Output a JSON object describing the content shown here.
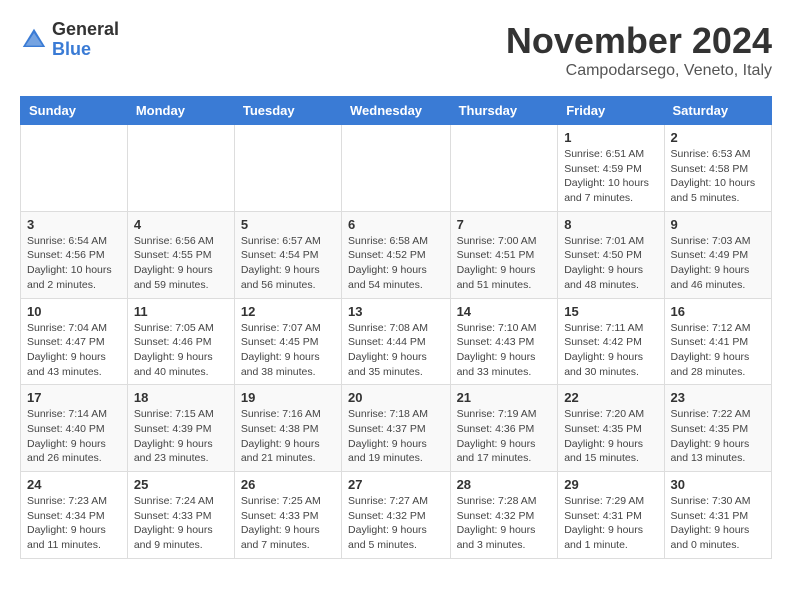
{
  "header": {
    "logo_general": "General",
    "logo_blue": "Blue",
    "month_title": "November 2024",
    "location": "Campodarsego, Veneto, Italy"
  },
  "weekdays": [
    "Sunday",
    "Monday",
    "Tuesday",
    "Wednesday",
    "Thursday",
    "Friday",
    "Saturday"
  ],
  "weeks": [
    [
      {
        "day": "",
        "info": ""
      },
      {
        "day": "",
        "info": ""
      },
      {
        "day": "",
        "info": ""
      },
      {
        "day": "",
        "info": ""
      },
      {
        "day": "",
        "info": ""
      },
      {
        "day": "1",
        "info": "Sunrise: 6:51 AM\nSunset: 4:59 PM\nDaylight: 10 hours and 7 minutes."
      },
      {
        "day": "2",
        "info": "Sunrise: 6:53 AM\nSunset: 4:58 PM\nDaylight: 10 hours and 5 minutes."
      }
    ],
    [
      {
        "day": "3",
        "info": "Sunrise: 6:54 AM\nSunset: 4:56 PM\nDaylight: 10 hours and 2 minutes."
      },
      {
        "day": "4",
        "info": "Sunrise: 6:56 AM\nSunset: 4:55 PM\nDaylight: 9 hours and 59 minutes."
      },
      {
        "day": "5",
        "info": "Sunrise: 6:57 AM\nSunset: 4:54 PM\nDaylight: 9 hours and 56 minutes."
      },
      {
        "day": "6",
        "info": "Sunrise: 6:58 AM\nSunset: 4:52 PM\nDaylight: 9 hours and 54 minutes."
      },
      {
        "day": "7",
        "info": "Sunrise: 7:00 AM\nSunset: 4:51 PM\nDaylight: 9 hours and 51 minutes."
      },
      {
        "day": "8",
        "info": "Sunrise: 7:01 AM\nSunset: 4:50 PM\nDaylight: 9 hours and 48 minutes."
      },
      {
        "day": "9",
        "info": "Sunrise: 7:03 AM\nSunset: 4:49 PM\nDaylight: 9 hours and 46 minutes."
      }
    ],
    [
      {
        "day": "10",
        "info": "Sunrise: 7:04 AM\nSunset: 4:47 PM\nDaylight: 9 hours and 43 minutes."
      },
      {
        "day": "11",
        "info": "Sunrise: 7:05 AM\nSunset: 4:46 PM\nDaylight: 9 hours and 40 minutes."
      },
      {
        "day": "12",
        "info": "Sunrise: 7:07 AM\nSunset: 4:45 PM\nDaylight: 9 hours and 38 minutes."
      },
      {
        "day": "13",
        "info": "Sunrise: 7:08 AM\nSunset: 4:44 PM\nDaylight: 9 hours and 35 minutes."
      },
      {
        "day": "14",
        "info": "Sunrise: 7:10 AM\nSunset: 4:43 PM\nDaylight: 9 hours and 33 minutes."
      },
      {
        "day": "15",
        "info": "Sunrise: 7:11 AM\nSunset: 4:42 PM\nDaylight: 9 hours and 30 minutes."
      },
      {
        "day": "16",
        "info": "Sunrise: 7:12 AM\nSunset: 4:41 PM\nDaylight: 9 hours and 28 minutes."
      }
    ],
    [
      {
        "day": "17",
        "info": "Sunrise: 7:14 AM\nSunset: 4:40 PM\nDaylight: 9 hours and 26 minutes."
      },
      {
        "day": "18",
        "info": "Sunrise: 7:15 AM\nSunset: 4:39 PM\nDaylight: 9 hours and 23 minutes."
      },
      {
        "day": "19",
        "info": "Sunrise: 7:16 AM\nSunset: 4:38 PM\nDaylight: 9 hours and 21 minutes."
      },
      {
        "day": "20",
        "info": "Sunrise: 7:18 AM\nSunset: 4:37 PM\nDaylight: 9 hours and 19 minutes."
      },
      {
        "day": "21",
        "info": "Sunrise: 7:19 AM\nSunset: 4:36 PM\nDaylight: 9 hours and 17 minutes."
      },
      {
        "day": "22",
        "info": "Sunrise: 7:20 AM\nSunset: 4:35 PM\nDaylight: 9 hours and 15 minutes."
      },
      {
        "day": "23",
        "info": "Sunrise: 7:22 AM\nSunset: 4:35 PM\nDaylight: 9 hours and 13 minutes."
      }
    ],
    [
      {
        "day": "24",
        "info": "Sunrise: 7:23 AM\nSunset: 4:34 PM\nDaylight: 9 hours and 11 minutes."
      },
      {
        "day": "25",
        "info": "Sunrise: 7:24 AM\nSunset: 4:33 PM\nDaylight: 9 hours and 9 minutes."
      },
      {
        "day": "26",
        "info": "Sunrise: 7:25 AM\nSunset: 4:33 PM\nDaylight: 9 hours and 7 minutes."
      },
      {
        "day": "27",
        "info": "Sunrise: 7:27 AM\nSunset: 4:32 PM\nDaylight: 9 hours and 5 minutes."
      },
      {
        "day": "28",
        "info": "Sunrise: 7:28 AM\nSunset: 4:32 PM\nDaylight: 9 hours and 3 minutes."
      },
      {
        "day": "29",
        "info": "Sunrise: 7:29 AM\nSunset: 4:31 PM\nDaylight: 9 hours and 1 minute."
      },
      {
        "day": "30",
        "info": "Sunrise: 7:30 AM\nSunset: 4:31 PM\nDaylight: 9 hours and 0 minutes."
      }
    ]
  ]
}
